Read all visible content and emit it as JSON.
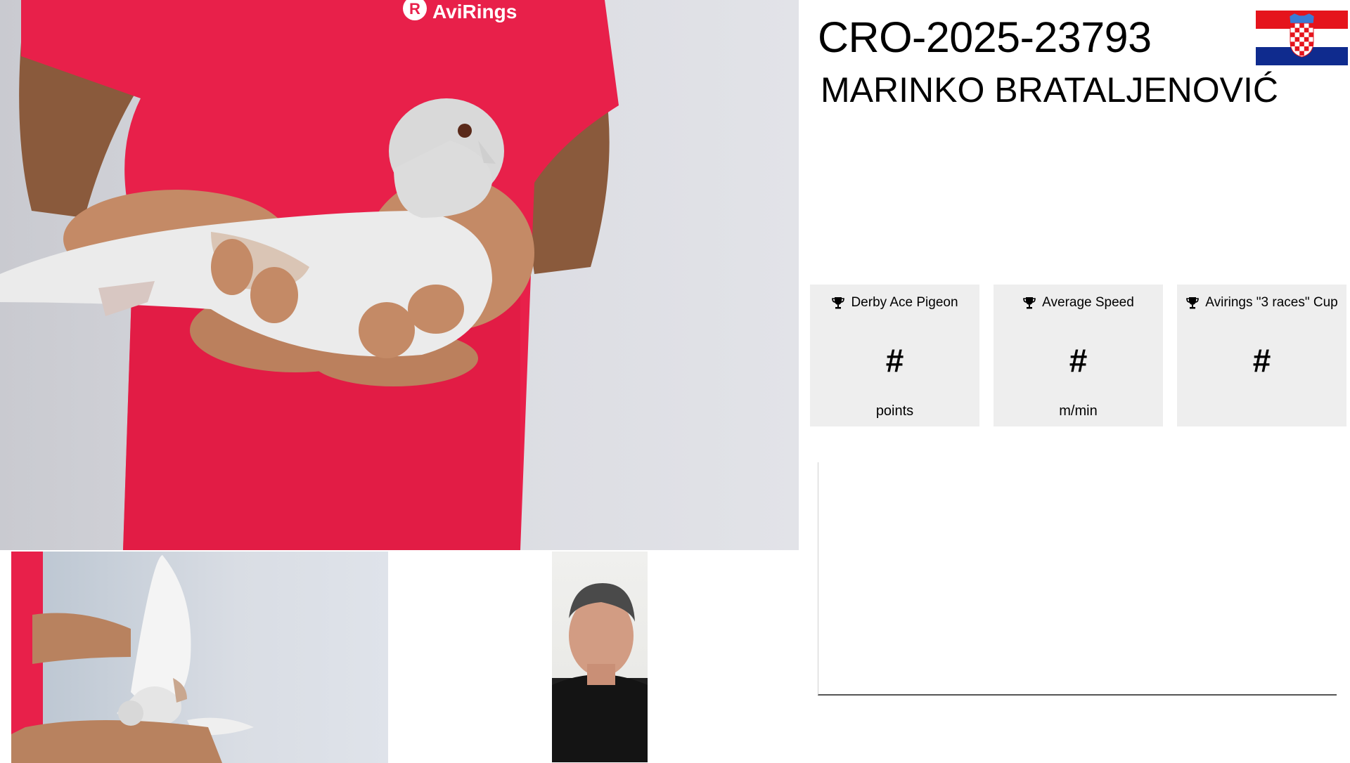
{
  "pigeon": {
    "ring_id": "CRO-2025-23793",
    "owner_name": "MARINKO BRATALJENOVIĆ",
    "country_flag": "croatia-flag",
    "shirt_logo_text": "AviRings"
  },
  "stats": [
    {
      "icon": "trophy-icon",
      "title": "Derby Ace Pigeon",
      "value": "#",
      "unit": "points"
    },
    {
      "icon": "trophy-icon",
      "title": "Average Speed",
      "value": "#",
      "unit": "m/min"
    },
    {
      "icon": "trophy-icon",
      "title": "Avirings \"3 races\" Cup",
      "value": "#",
      "unit": ""
    }
  ],
  "colors": {
    "card_background": "#eeeeee",
    "shirt_red": "#e8204a",
    "flag_red": "#e5141c",
    "flag_white": "#ffffff",
    "flag_blue": "#0f2b8e"
  }
}
